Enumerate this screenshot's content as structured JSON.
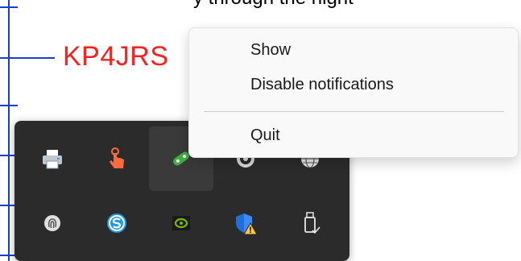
{
  "background": {
    "top_text": "y through the night",
    "callsign": "KP4JRS",
    "callsign_color": "#ff1f1f",
    "line_color": "#1a3fd0"
  },
  "context_menu": {
    "items": [
      {
        "label": "Show"
      },
      {
        "label": "Disable notifications"
      },
      {
        "label": "Quit"
      }
    ]
  },
  "tray_overflow": {
    "icons": [
      {
        "name": "printer-icon",
        "hovered": false
      },
      {
        "name": "touch-hand-icon",
        "hovered": false
      },
      {
        "name": "green-app-icon",
        "hovered": true
      },
      {
        "name": "speaker-icon",
        "hovered": false
      },
      {
        "name": "globe-icon",
        "hovered": false
      },
      {
        "name": "fingerprint-icon",
        "hovered": false
      },
      {
        "name": "skype-icon",
        "hovered": false
      },
      {
        "name": "nvidia-icon",
        "hovered": false
      },
      {
        "name": "defender-warning-icon",
        "hovered": false
      },
      {
        "name": "usb-drive-icon",
        "hovered": false
      }
    ]
  }
}
